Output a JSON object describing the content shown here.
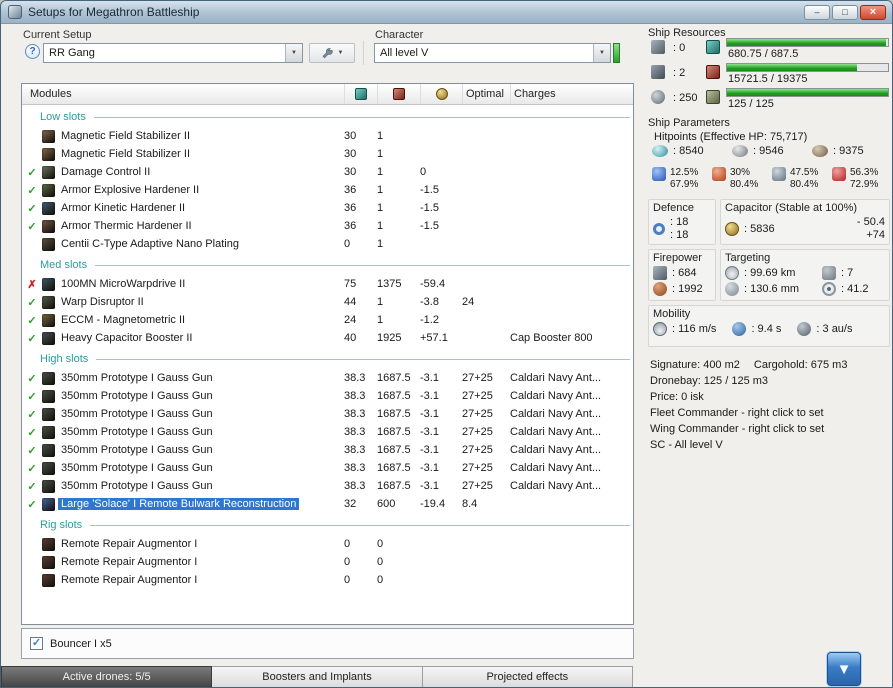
{
  "window": {
    "title": "Setups for Megathron Battleship",
    "minimize_glyph": "–",
    "maximize_glyph": "□",
    "close_glyph": "×"
  },
  "glyphs": {
    "dropdown": "▼",
    "check": "✓",
    "scroll_down": "▼"
  },
  "toolbar": {
    "setup_label": "Current Setup",
    "setup_value": "RR Gang",
    "help_glyph": "?",
    "character_label": "Character",
    "character_value": "All level V"
  },
  "modules": {
    "header": "Modules",
    "optimal_header": "Optimal",
    "charges_header": "Charges",
    "low": {
      "title": "Low slots",
      "rows": [
        {
          "st": "",
          "ic": "#8a6c4c",
          "name": "Magnetic Field Stabilizer II",
          "c1": "30",
          "c2": "1",
          "c3": "",
          "opt": "",
          "chg": ""
        },
        {
          "st": "",
          "ic": "#8a6c4c",
          "name": "Magnetic Field Stabilizer II",
          "c1": "30",
          "c2": "1",
          "c3": "",
          "opt": "",
          "chg": ""
        },
        {
          "st": "ok",
          "ic": "#6f7a64",
          "name": "Damage Control II",
          "c1": "30",
          "c2": "1",
          "c3": "0",
          "opt": "",
          "chg": ""
        },
        {
          "st": "ok",
          "ic": "#5e7046",
          "name": "Armor Explosive Hardener II",
          "c1": "36",
          "c2": "1",
          "c3": "-1.5",
          "opt": "",
          "chg": ""
        },
        {
          "st": "ok",
          "ic": "#46627a",
          "name": "Armor Kinetic Hardener II",
          "c1": "36",
          "c2": "1",
          "c3": "-1.5",
          "opt": "",
          "chg": ""
        },
        {
          "st": "ok",
          "ic": "#7a5a46",
          "name": "Armor Thermic Hardener II",
          "c1": "36",
          "c2": "1",
          "c3": "-1.5",
          "opt": "",
          "chg": ""
        },
        {
          "st": "",
          "ic": "#5c5444",
          "name": "Centii C-Type Adaptive Nano Plating",
          "c1": "0",
          "c2": "1",
          "c3": "",
          "opt": "",
          "chg": ""
        }
      ]
    },
    "med": {
      "title": "Med slots",
      "rows": [
        {
          "st": "bad",
          "ic": "#3e5c6a",
          "name": "100MN MicroWarpdrive II",
          "c1": "75",
          "c2": "1375",
          "c3": "-59.4",
          "opt": "",
          "chg": ""
        },
        {
          "st": "ok",
          "ic": "#566049",
          "name": "Warp Disruptor II",
          "c1": "44",
          "c2": "1",
          "c3": "-3.8",
          "opt": "24",
          "chg": ""
        },
        {
          "st": "ok",
          "ic": "#7c6a40",
          "name": "ECCM - Magnetometric II",
          "c1": "24",
          "c2": "1",
          "c3": "-1.2",
          "opt": "",
          "chg": ""
        },
        {
          "st": "ok",
          "ic": "#50505a",
          "name": "Heavy Capacitor Booster II",
          "c1": "40",
          "c2": "1925",
          "c3": "+57.1",
          "opt": "",
          "chg": "Cap Booster 800"
        }
      ]
    },
    "high": {
      "title": "High slots",
      "rows": [
        {
          "st": "ok",
          "ic": "#4c5449",
          "name": "350mm Prototype I Gauss Gun",
          "c1": "38.3",
          "c2": "1687.5",
          "c3": "-3.1",
          "opt": "27+25",
          "chg": "Caldari Navy Ant..."
        },
        {
          "st": "ok",
          "ic": "#4c5449",
          "name": "350mm Prototype I Gauss Gun",
          "c1": "38.3",
          "c2": "1687.5",
          "c3": "-3.1",
          "opt": "27+25",
          "chg": "Caldari Navy Ant..."
        },
        {
          "st": "ok",
          "ic": "#4c5449",
          "name": "350mm Prototype I Gauss Gun",
          "c1": "38.3",
          "c2": "1687.5",
          "c3": "-3.1",
          "opt": "27+25",
          "chg": "Caldari Navy Ant..."
        },
        {
          "st": "ok",
          "ic": "#4c5449",
          "name": "350mm Prototype I Gauss Gun",
          "c1": "38.3",
          "c2": "1687.5",
          "c3": "-3.1",
          "opt": "27+25",
          "chg": "Caldari Navy Ant..."
        },
        {
          "st": "ok",
          "ic": "#4c5449",
          "name": "350mm Prototype I Gauss Gun",
          "c1": "38.3",
          "c2": "1687.5",
          "c3": "-3.1",
          "opt": "27+25",
          "chg": "Caldari Navy Ant..."
        },
        {
          "st": "ok",
          "ic": "#4c5449",
          "name": "350mm Prototype I Gauss Gun",
          "c1": "38.3",
          "c2": "1687.5",
          "c3": "-3.1",
          "opt": "27+25",
          "chg": "Caldari Navy Ant..."
        },
        {
          "st": "ok",
          "ic": "#4c5449",
          "name": "350mm Prototype I Gauss Gun",
          "c1": "38.3",
          "c2": "1687.5",
          "c3": "-3.1",
          "opt": "27+25",
          "chg": "Caldari Navy Ant..."
        },
        {
          "st": "ok",
          "ic": "#4a69a8",
          "name": "Large 'Solace' I Remote Bulwark Reconstruction",
          "c1": "32",
          "c2": "600",
          "c3": "-19.4",
          "opt": "8.4",
          "chg": "",
          "sel": true
        }
      ]
    },
    "rig": {
      "title": "Rig slots",
      "rows": [
        {
          "st": "",
          "ic": "#5e4038",
          "name": "Remote Repair Augmentor I",
          "c1": "0",
          "c2": "0",
          "c3": "",
          "opt": "",
          "chg": ""
        },
        {
          "st": "",
          "ic": "#5e4038",
          "name": "Remote Repair Augmentor I",
          "c1": "0",
          "c2": "0",
          "c3": "",
          "opt": "",
          "chg": ""
        },
        {
          "st": "",
          "ic": "#5e4038",
          "name": "Remote Repair Augmentor I",
          "c1": "0",
          "c2": "0",
          "c3": "",
          "opt": "",
          "chg": ""
        }
      ]
    }
  },
  "drones": {
    "label": "Bouncer I x5"
  },
  "tabs": {
    "drones": "Active drones: 5/5",
    "boosters": "Boosters and Implants",
    "projected": "Projected effects"
  },
  "resources": {
    "title": "Ship Resources",
    "turrets": ": 0",
    "launchers": ": 2",
    "calibration": ": 250",
    "cpu_text": "680.75 / 687.5",
    "cpu_pct": 99,
    "pg_text": "15721.5 / 19375",
    "pg_pct": 81,
    "bw_text": "125 / 125",
    "bw_pct": 100
  },
  "parameters": {
    "title": "Ship Parameters",
    "hitpoints": "Hitpoints (Effective HP: 75,717)",
    "shield": ": 8540",
    "armor": ": 9546",
    "structure": ": 9375",
    "resists": [
      [
        "12.5%",
        "67.9%"
      ],
      [
        "30%",
        "80.4%"
      ],
      [
        "47.5%",
        "80.4%"
      ],
      [
        "56.3%",
        "72.9%"
      ]
    ],
    "defence": {
      "title": "Defence",
      "v1": ": 18",
      "v2": ": 18"
    },
    "capacitor": {
      "title": "Capacitor (Stable at 100%)",
      "amount": ": 5836",
      "drain": "- 50.4",
      "peak": "+74"
    },
    "firepower": {
      "title": "Firepower",
      "volley": ": 684",
      "dps": ": 1992"
    },
    "targeting": {
      "title": "Targeting",
      "range": ": 99.69 km",
      "max_targets": ": 7",
      "scan_res": ": 130.6 mm",
      "sensor": ": 41.2"
    },
    "mobility": {
      "title": "Mobility",
      "speed": ": 116 m/s",
      "align": ": 9.4 s",
      "warp": ": 3 au/s"
    },
    "info": {
      "signature": "Signature: 400 m2",
      "cargohold": "Cargohold: 675 m3",
      "dronebay": "Dronebay: 125 / 125 m3",
      "price": "Price: 0 isk",
      "fleet": "Fleet Commander - right click to set",
      "wing": "Wing Commander - right click to set",
      "sc": "SC - All level V"
    }
  }
}
